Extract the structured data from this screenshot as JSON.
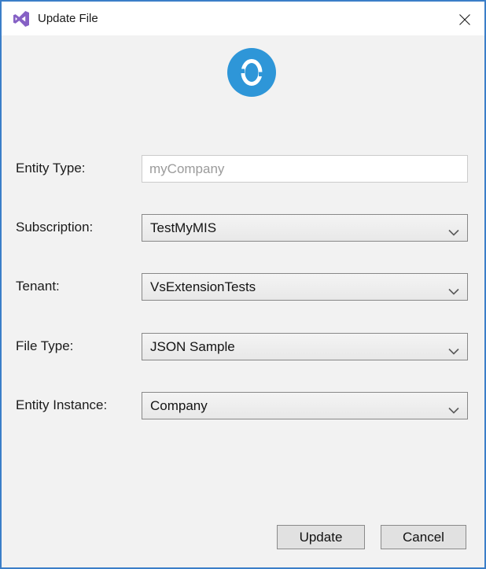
{
  "window": {
    "title": "Update File",
    "border_color": "#3b7ec8",
    "titlebar_bg": "#ffffff",
    "content_bg": "#f2f2f2"
  },
  "icons": {
    "app_icon": "visual-studio-logo",
    "app_icon_color": "#8661c5",
    "close_icon": "close-x",
    "loading_icon": "blue-circle-spinner",
    "loading_icon_color": "#2e96d8",
    "chevron_icon": "chevron-down"
  },
  "form": {
    "fields": [
      {
        "label": "Entity Type:",
        "value": "myCompany",
        "type": "text"
      },
      {
        "label": "Subscription:",
        "value": "TestMyMIS",
        "type": "combobox"
      },
      {
        "label": "Tenant:",
        "value": "VsExtensionTests",
        "type": "combobox"
      },
      {
        "label": "File Type:",
        "value": "JSON Sample",
        "type": "combobox"
      },
      {
        "label": "Entity Instance:",
        "value": "Company",
        "type": "combobox"
      }
    ]
  },
  "buttons": {
    "update_label": "Update",
    "cancel_label": "Cancel"
  }
}
